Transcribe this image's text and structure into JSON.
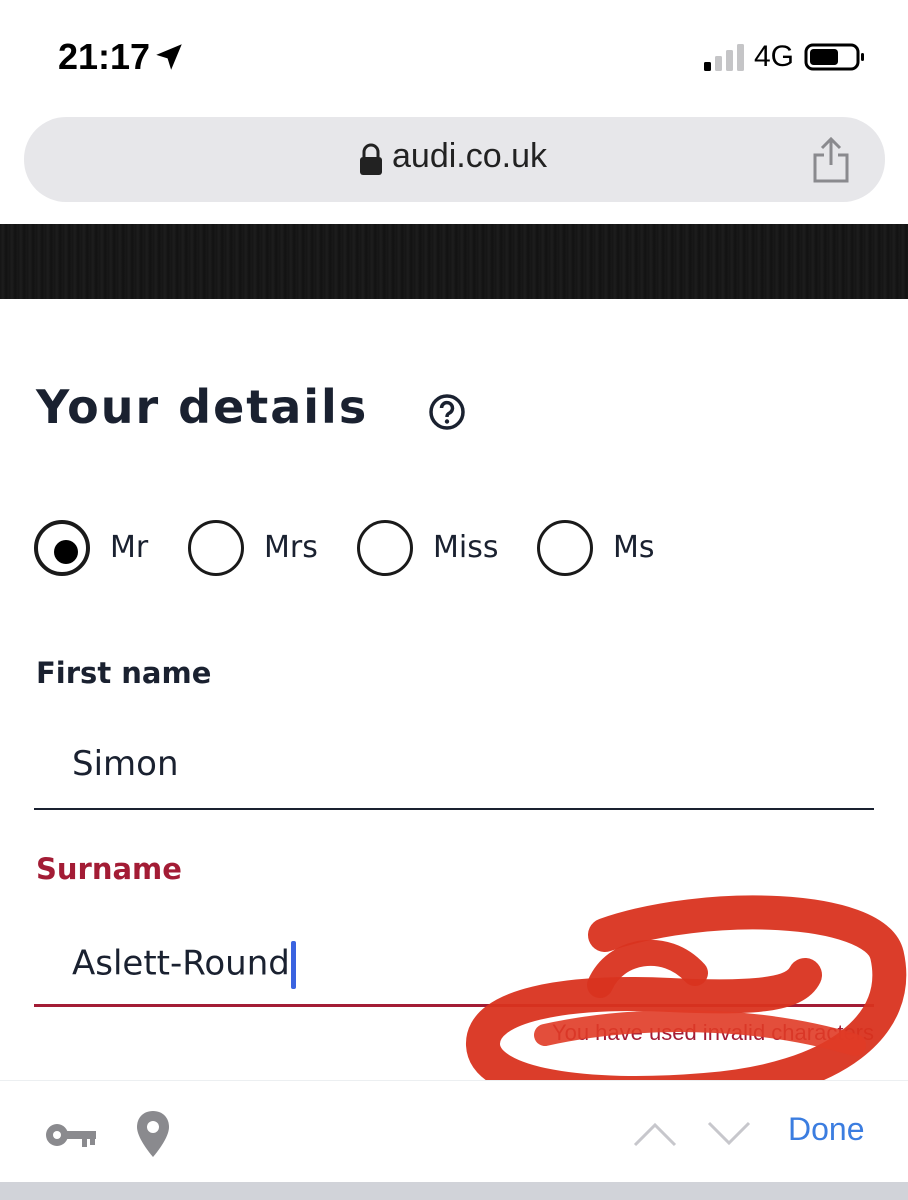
{
  "status_bar": {
    "time": "21:17",
    "network": "4G"
  },
  "browser": {
    "url": "audi.co.uk"
  },
  "form": {
    "title": "Your details",
    "titles": [
      {
        "label": "Mr",
        "selected": true
      },
      {
        "label": "Mrs",
        "selected": false
      },
      {
        "label": "Miss",
        "selected": false
      },
      {
        "label": "Ms",
        "selected": false
      }
    ],
    "first_name": {
      "label": "First name",
      "value": "Simon"
    },
    "surname": {
      "label": "Surname",
      "value": "Aslett-Round",
      "error": "You have used invalid characters"
    }
  },
  "keyboard_bar": {
    "done_label": "Done"
  },
  "colors": {
    "error": "#a31c35",
    "text": "#1a2130",
    "link": "#3b7de0",
    "annotation": "#d9331f"
  }
}
